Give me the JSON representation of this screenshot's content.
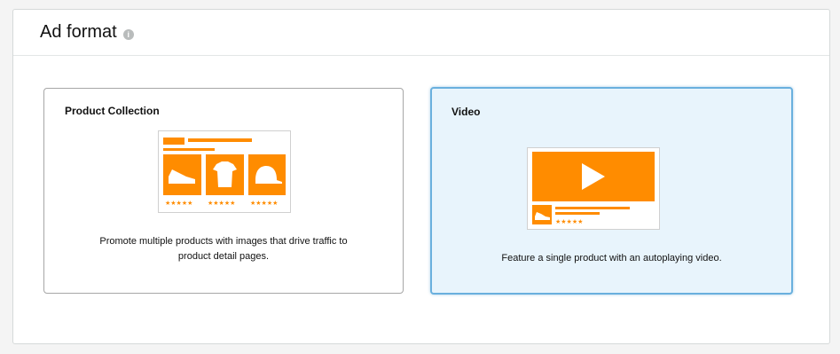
{
  "header": {
    "title": "Ad format",
    "info_icon": "info-icon"
  },
  "formats": [
    {
      "title": "Product Collection",
      "description": "Promote multiple products with images that drive traffic to product detail pages.",
      "selected": false,
      "illustration_icons": [
        "sneaker-icon",
        "tshirt-icon",
        "cap-icon",
        "rating-stars-icon"
      ]
    },
    {
      "title": "Video",
      "description": "Feature a single product with an autoplaying video.",
      "selected": true,
      "illustration_icons": [
        "play-icon",
        "sneaker-icon",
        "rating-stars-icon"
      ]
    }
  ],
  "colors": {
    "accent_orange": "#ff8c00",
    "selected_border": "#6ab0de",
    "selected_background": "#e8f4fc"
  },
  "stars_glyph": "★★★★★"
}
